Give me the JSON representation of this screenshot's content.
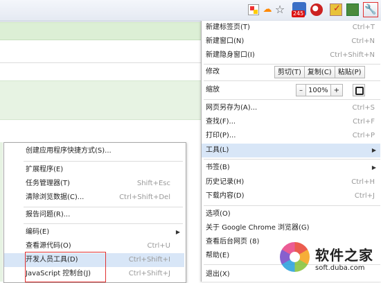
{
  "toolbar": {
    "badge": "245",
    "icons": [
      "page-icon",
      "cloud-icon",
      "star-icon",
      "extension-icon",
      "record-icon",
      "check-icon",
      "clip-icon",
      "wrench-icon"
    ]
  },
  "menu": {
    "new_tab": {
      "label": "新建标签页(T)",
      "shortcut": "Ctrl+T"
    },
    "new_window": {
      "label": "新建窗口(N)",
      "shortcut": "Ctrl+N"
    },
    "new_incognito": {
      "label": "新建隐身窗口(I)",
      "shortcut": "Ctrl+Shift+N"
    },
    "edit": {
      "label": "修改",
      "cut": "剪切(T)",
      "copy": "复制(C)",
      "paste": "粘贴(P)"
    },
    "zoom": {
      "label": "缩放",
      "minus": "–",
      "value": "100%",
      "plus": "+"
    },
    "save_as": {
      "label": "网页另存为(A)...",
      "shortcut": "Ctrl+S"
    },
    "find": {
      "label": "查找(F)...",
      "shortcut": "Ctrl+F"
    },
    "print": {
      "label": "打印(P)...",
      "shortcut": "Ctrl+P"
    },
    "tools": {
      "label": "工具(L)"
    },
    "bookmarks": {
      "label": "书签(B)"
    },
    "history": {
      "label": "历史记录(H)",
      "shortcut": "Ctrl+H"
    },
    "downloads": {
      "label": "下载内容(D)",
      "shortcut": "Ctrl+J"
    },
    "options": {
      "label": "选项(O)"
    },
    "about": {
      "label": "关于 Google Chrome 浏览器(G)"
    },
    "background": {
      "label": "查看后台网页 (8)"
    },
    "help": {
      "label": "帮助(E)"
    },
    "exit": {
      "label": "退出(X)"
    }
  },
  "submenu": {
    "create_shortcut": {
      "label": "创建应用程序快捷方式(S)..."
    },
    "extensions": {
      "label": "扩展程序(E)"
    },
    "task_manager": {
      "label": "任务管理器(T)",
      "shortcut": "Shift+Esc"
    },
    "clear_data": {
      "label": "清除浏览数据(C)...",
      "shortcut": "Ctrl+Shift+Del"
    },
    "report_issue": {
      "label": "报告问题(R)..."
    },
    "encoding": {
      "label": "编码(E)"
    },
    "view_source": {
      "label": "查看源代码(O)",
      "shortcut": "Ctrl+U"
    },
    "dev_tools": {
      "label": "开发人员工具(D)",
      "shortcut": "Ctrl+Shift+I"
    },
    "js_console": {
      "label": "JavaScript 控制台(J)",
      "shortcut": "Ctrl+Shift+J"
    }
  },
  "watermark": {
    "title": "软件之家",
    "url": "soft.duba.com"
  }
}
